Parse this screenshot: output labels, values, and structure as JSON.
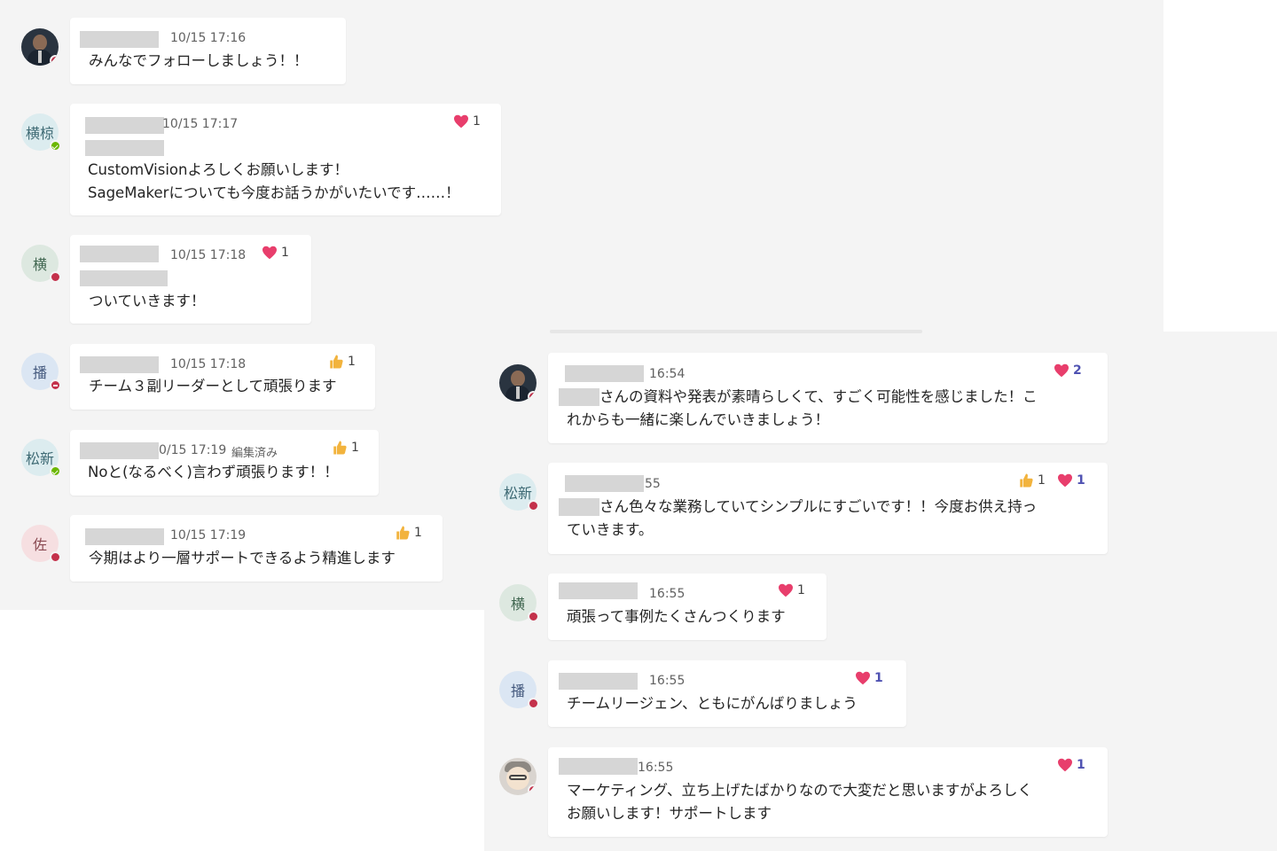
{
  "left_thread": [
    {
      "avatar": "photo",
      "status": "dnd",
      "time": "10/15 17:16",
      "text": [
        "みんなでフォローしましょう！！"
      ],
      "reaction": null
    },
    {
      "avatar": "text",
      "initials": "横椋",
      "status": "green",
      "time": "10/15 17:17",
      "text": [
        "CustomVisionよろしくお願いします！",
        "SageMakerについても今度お話うかがいたいです……！"
      ],
      "reaction": {
        "type": "heart",
        "count": "1"
      }
    },
    {
      "avatar": "text",
      "initials": "横",
      "status": "red",
      "time": "10/15 17:18",
      "text": [
        "ついていきます！"
      ],
      "reaction": {
        "type": "heart",
        "count": "1"
      }
    },
    {
      "avatar": "text",
      "initials": "播",
      "status": "dnd",
      "time": "10/15 17:18",
      "text": [
        "チーム３副リーダーとして頑張ります"
      ],
      "reaction": {
        "type": "thumb",
        "count": "1"
      }
    },
    {
      "avatar": "text",
      "initials": "松新",
      "status": "green",
      "time": "0/15 17:19",
      "edited": "編集済み",
      "text": [
        "Noと(なるべく)言わず頑張ります！！"
      ],
      "reaction": {
        "type": "thumb",
        "count": "1"
      }
    },
    {
      "avatar": "text",
      "initials": "佐",
      "status": "red",
      "time": "10/15 17:19",
      "text": [
        "今期はより一層サポートできるよう精進します"
      ],
      "reaction": {
        "type": "thumb",
        "count": "1"
      }
    }
  ],
  "right_thread": [
    {
      "avatar": "photo",
      "status": "red",
      "time": "16:54",
      "text": [
        "さんの資料や発表が素晴らしくて、すごく可能性を感じました！こ",
        "れからも一緒に楽しんでいきましょう！"
      ],
      "reactions": [
        {
          "type": "heart",
          "count": "2"
        }
      ]
    },
    {
      "avatar": "text",
      "initials": "松新",
      "status": "red",
      "time": "55",
      "text": [
        "さん色々な業務していてシンプルにすごいです！！今度お供え持っ",
        "ていきます。"
      ],
      "reactions": [
        {
          "type": "thumb",
          "count": "1"
        },
        {
          "type": "heart",
          "count": "1"
        }
      ]
    },
    {
      "avatar": "text",
      "initials": "横",
      "status": "red",
      "time": "16:55",
      "text": [
        "頑張って事例たくさんつくります"
      ],
      "reactions": [
        {
          "type": "heart",
          "count": "1"
        }
      ]
    },
    {
      "avatar": "text",
      "initials": "播",
      "status": "red",
      "time": "16:55",
      "text": [
        "チームリージェン、ともにがんばりましょう"
      ],
      "reactions": [
        {
          "type": "heart",
          "count": "1"
        }
      ]
    },
    {
      "avatar": "cartoon",
      "status": "red",
      "time": "16:55",
      "text": [
        "マーケティング、立ち上げたばかりなので大変だと思いますがよろしく",
        "お願いします！サポートします"
      ],
      "reactions": [
        {
          "type": "heart",
          "count": "1"
        }
      ]
    }
  ],
  "colors": {
    "heart": "#e83e6c",
    "thumb": "#f2b33d",
    "accent": "#4f52b2",
    "status_red": "#c4314b",
    "status_green": "#6bb700"
  }
}
